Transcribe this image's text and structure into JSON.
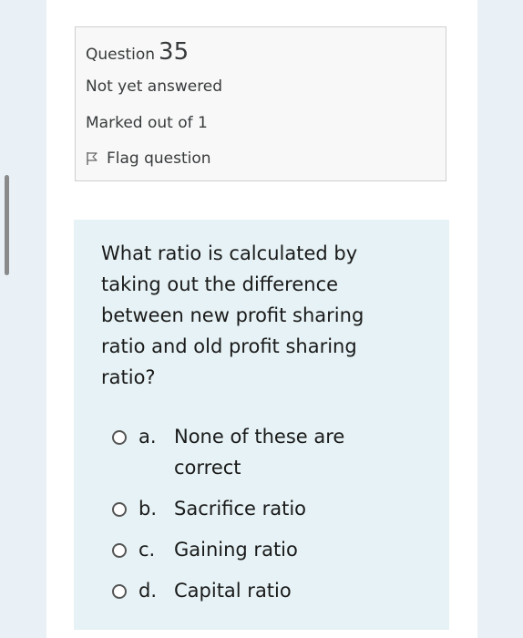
{
  "info": {
    "question_word": "Question",
    "question_number": "35",
    "state": "Not yet answered",
    "grade": "Marked out of 1",
    "flag_label": "Flag question"
  },
  "question": {
    "text": "What ratio is calculated by taking out the difference between new profit sharing ratio and old profit sharing ratio?",
    "options": [
      {
        "letter": "a.",
        "text": "None of these are correct"
      },
      {
        "letter": "b.",
        "text": "Sacrifice ratio"
      },
      {
        "letter": "c.",
        "text": "Gaining ratio"
      },
      {
        "letter": "d.",
        "text": "Capital ratio"
      }
    ]
  },
  "icons": {
    "flag": "flag-icon",
    "radio": "radio-button-unselected"
  },
  "colors": {
    "background": "#e9f1f6",
    "panel": "#ffffff",
    "info_box": "#f8f8f8",
    "question_box": "#e6f2f5",
    "text": "#1a1a1a"
  }
}
